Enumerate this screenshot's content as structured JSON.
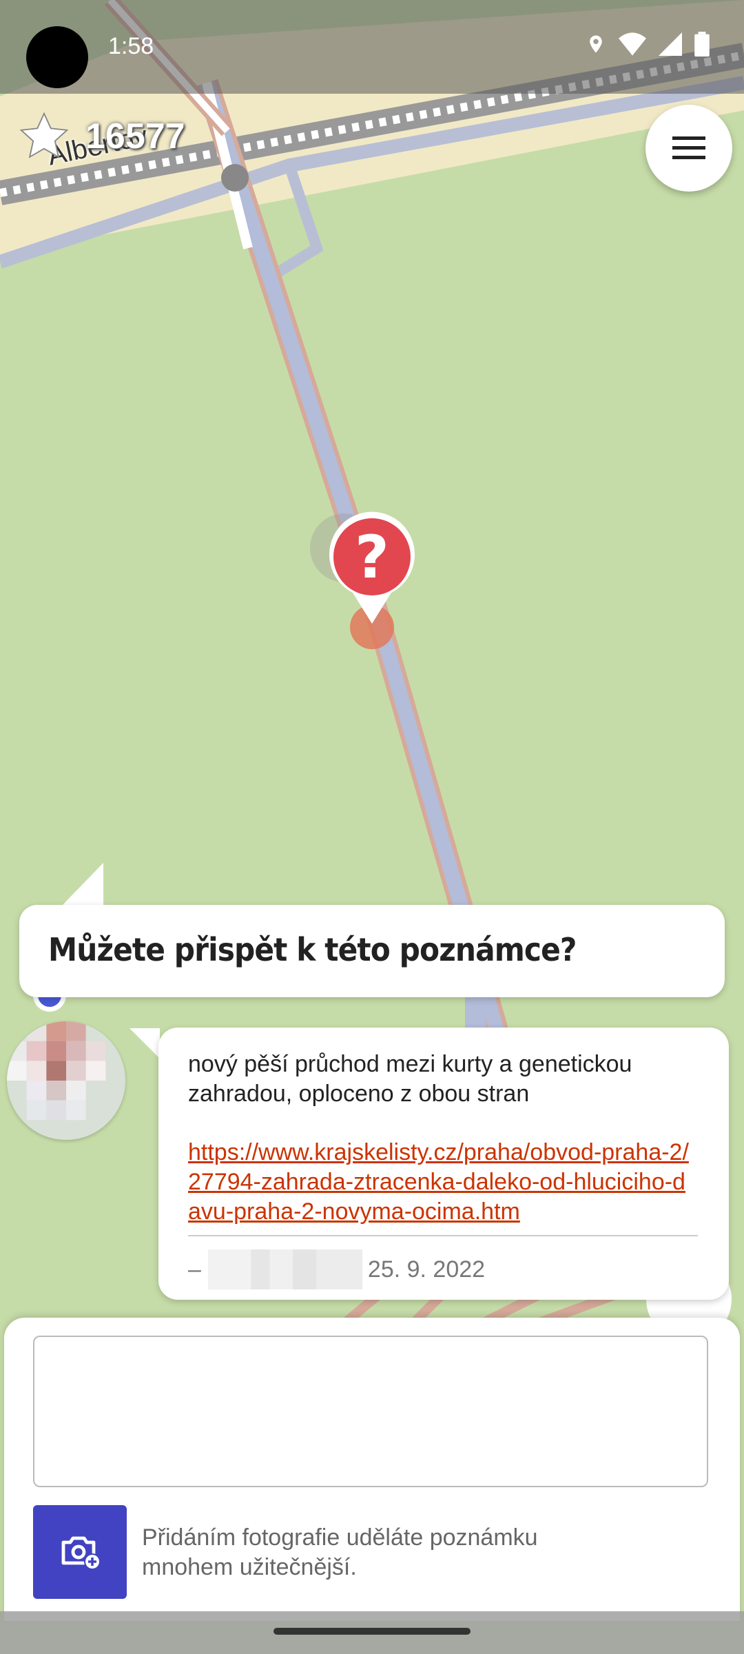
{
  "status_bar": {
    "time": "1:58",
    "icons": [
      "location-icon",
      "wifi-icon",
      "signal-icon",
      "battery-icon"
    ]
  },
  "map": {
    "street_label": "Albertov",
    "pin_glyph": "?"
  },
  "stars": {
    "count": "16577",
    "icon": "star-icon"
  },
  "menu": {
    "icon": "hamburger-menu-icon"
  },
  "tip": {
    "title": "Můžete přispět k této poznámce?"
  },
  "note": {
    "text": "nový pěší průchod mezi kurty a genetickou zahradou, oploceno z obou stran",
    "link": "https://www.krajskelisty.cz/praha/obvod-praha-2/27794-zahrada-ztracenka-daleko-od-hluciciho-davu-praha-2-novyma-ocima.htm",
    "dash": "–",
    "date": "25. 9. 2022"
  },
  "compose": {
    "comment_value": "",
    "comment_placeholder": "",
    "photo_icon": "add-photo-icon",
    "photo_hint": "Přidáním fotografie uděláte poznámku mnohem užitečnější."
  },
  "colors": {
    "map_green": "#c6dca8",
    "accent": "#4143c2",
    "pin_red": "#e2474f",
    "link": "#cc3300"
  }
}
